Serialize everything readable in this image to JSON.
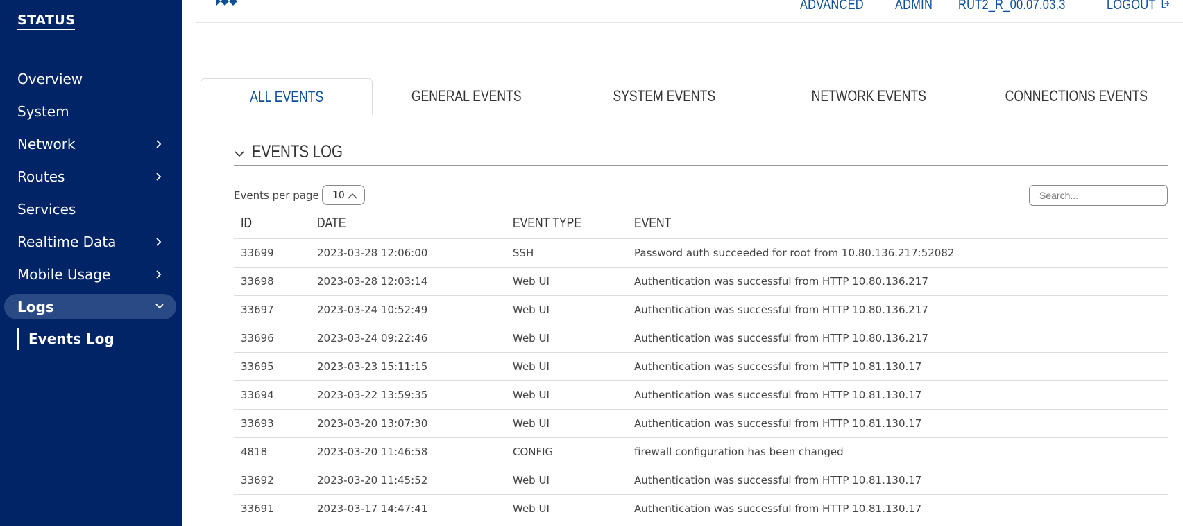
{
  "sidebar": {
    "title": "STATUS",
    "items": [
      {
        "label": "Overview",
        "has_children": false
      },
      {
        "label": "System",
        "has_children": false
      },
      {
        "label": "Network",
        "has_children": true
      },
      {
        "label": "Routes",
        "has_children": true
      },
      {
        "label": "Services",
        "has_children": false
      },
      {
        "label": "Realtime Data",
        "has_children": true
      },
      {
        "label": "Mobile Usage",
        "has_children": true
      },
      {
        "label": "Logs",
        "has_children": true,
        "expanded": true
      }
    ],
    "sub_item": "Events Log",
    "colors": {
      "background": "#002466",
      "active": "#2a4a85"
    }
  },
  "header": {
    "links": [
      "ADVANCED",
      "ADMIN",
      "RUT2_R_00.07.03.3",
      "LOGOUT"
    ],
    "link_color": "#0e4f9c"
  },
  "tabs": [
    {
      "label": "ALL EVENTS",
      "active": true
    },
    {
      "label": "GENERAL EVENTS",
      "active": false
    },
    {
      "label": "SYSTEM EVENTS",
      "active": false
    },
    {
      "label": "NETWORK EVENTS",
      "active": false
    },
    {
      "label": "CONNECTIONS EVENTS",
      "active": false
    }
  ],
  "section": {
    "title": "EVENTS LOG",
    "per_page_label": "Events per page",
    "per_page_value": "10",
    "search_placeholder": "Search..."
  },
  "table": {
    "columns": [
      "ID",
      "DATE",
      "EVENT TYPE",
      "EVENT"
    ],
    "rows": [
      [
        "33699",
        "2023-03-28 12:06:00",
        "SSH",
        "Password auth succeeded for root from 10.80.136.217:52082"
      ],
      [
        "33698",
        "2023-03-28 12:03:14",
        "Web UI",
        "Authentication was successful from HTTP 10.80.136.217"
      ],
      [
        "33697",
        "2023-03-24 10:52:49",
        "Web UI",
        "Authentication was successful from HTTP 10.80.136.217"
      ],
      [
        "33696",
        "2023-03-24 09:22:46",
        "Web UI",
        "Authentication was successful from HTTP 10.80.136.217"
      ],
      [
        "33695",
        "2023-03-23 15:11:15",
        "Web UI",
        "Authentication was successful from HTTP 10.81.130.17"
      ],
      [
        "33694",
        "2023-03-22 13:59:35",
        "Web UI",
        "Authentication was successful from HTTP 10.81.130.17"
      ],
      [
        "33693",
        "2023-03-20 13:07:30",
        "Web UI",
        "Authentication was successful from HTTP 10.81.130.17"
      ],
      [
        "4818",
        "2023-03-20 11:46:58",
        "CONFIG",
        "firewall configuration has been changed"
      ],
      [
        "33692",
        "2023-03-20 11:45:52",
        "Web UI",
        "Authentication was successful from HTTP 10.81.130.17"
      ],
      [
        "33691",
        "2023-03-17 14:47:41",
        "Web UI",
        "Authentication was successful from HTTP 10.81.130.17"
      ]
    ]
  },
  "icons": {
    "chevron_right": "chevron-right-icon",
    "chevron_down": "chevron-down-icon",
    "chevron_up": "chevron-up-icon",
    "logout": "logout-icon",
    "logo": "logo-icon"
  }
}
